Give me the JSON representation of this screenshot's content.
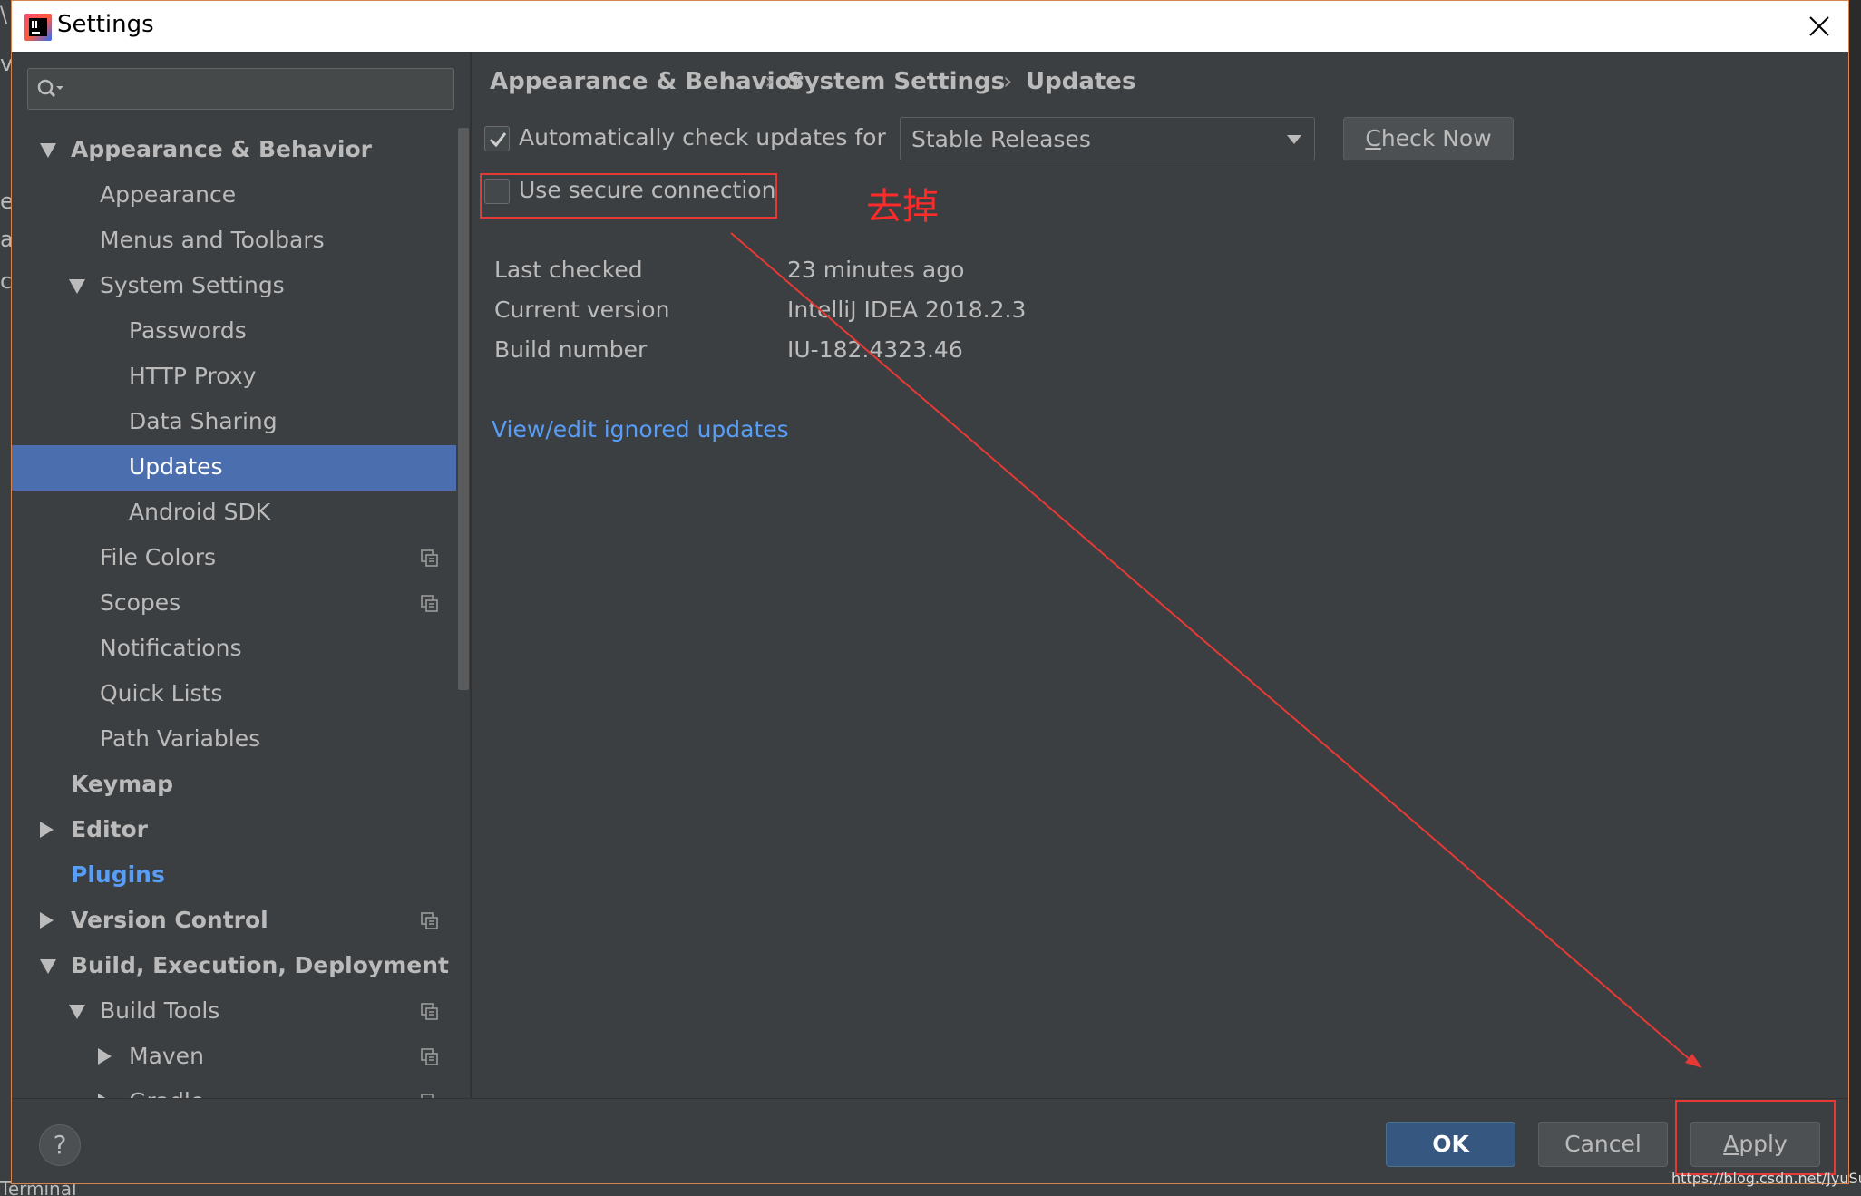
{
  "window": {
    "title": "Settings"
  },
  "backdrop": {
    "left_glyphs": [
      "\\",
      "v",
      "e",
      "a",
      "c"
    ],
    "bottom_text": "Terminal"
  },
  "search": {
    "placeholder": ""
  },
  "sidebar": {
    "items": [
      {
        "label": "Appearance & Behavior",
        "level": 0,
        "arrow": "down",
        "bold": true
      },
      {
        "label": "Appearance",
        "level": 1
      },
      {
        "label": "Menus and Toolbars",
        "level": 1
      },
      {
        "label": "System Settings",
        "level": 1,
        "arrow": "down"
      },
      {
        "label": "Passwords",
        "level": 2
      },
      {
        "label": "HTTP Proxy",
        "level": 2
      },
      {
        "label": "Data Sharing",
        "level": 2
      },
      {
        "label": "Updates",
        "level": 2,
        "selected": true
      },
      {
        "label": "Android SDK",
        "level": 2
      },
      {
        "label": "File Colors",
        "level": 1,
        "copy_icon": true
      },
      {
        "label": "Scopes",
        "level": 1,
        "copy_icon": true
      },
      {
        "label": "Notifications",
        "level": 1
      },
      {
        "label": "Quick Lists",
        "level": 1
      },
      {
        "label": "Path Variables",
        "level": 1
      },
      {
        "label": "Keymap",
        "level": 0,
        "bold": true
      },
      {
        "label": "Editor",
        "level": 0,
        "arrow": "right",
        "bold": true
      },
      {
        "label": "Plugins",
        "level": 0,
        "link": true
      },
      {
        "label": "Version Control",
        "level": 0,
        "arrow": "right",
        "bold": true,
        "copy_icon": true
      },
      {
        "label": "Build, Execution, Deployment",
        "level": 0,
        "arrow": "down",
        "bold": true
      },
      {
        "label": "Build Tools",
        "level": 1,
        "arrow": "down",
        "copy_icon": true
      },
      {
        "label": "Maven",
        "level": 2,
        "arrow": "right",
        "copy_icon": true
      },
      {
        "label": "Gradle",
        "level": 2,
        "arrow": "right",
        "copy_icon": true
      }
    ]
  },
  "breadcrumb": {
    "items": [
      "Appearance & Behavior",
      "System Settings",
      "Updates"
    ],
    "separator": "›"
  },
  "updates": {
    "auto_check_label": "Automatically check updates for",
    "auto_check_checked": true,
    "channel": "Stable Releases",
    "check_now_mnemonic": "C",
    "check_now_rest": "heck Now",
    "secure_label": "Use secure connection",
    "secure_checked": false,
    "info": [
      {
        "key": "Last checked",
        "value": "23 minutes ago"
      },
      {
        "key": "Current version",
        "value": "IntelliJ IDEA 2018.2.3"
      },
      {
        "key": "Build number",
        "value": "IU-182.4323.46"
      }
    ],
    "ignored_link": "View/edit ignored updates"
  },
  "footer": {
    "help": "?",
    "ok": "OK",
    "cancel": "Cancel",
    "apply_mnemonic": "A",
    "apply_rest": "pply"
  },
  "annotation": {
    "text": "去掉",
    "color": "#ff2a2a"
  },
  "watermark": "https://blog.csdn.net/JyuSun",
  "colors": {
    "background": "#3c3f41",
    "selection": "#4b6eaf",
    "link": "#589df6",
    "text": "#bbbbbb",
    "primary_button": "#365880"
  }
}
